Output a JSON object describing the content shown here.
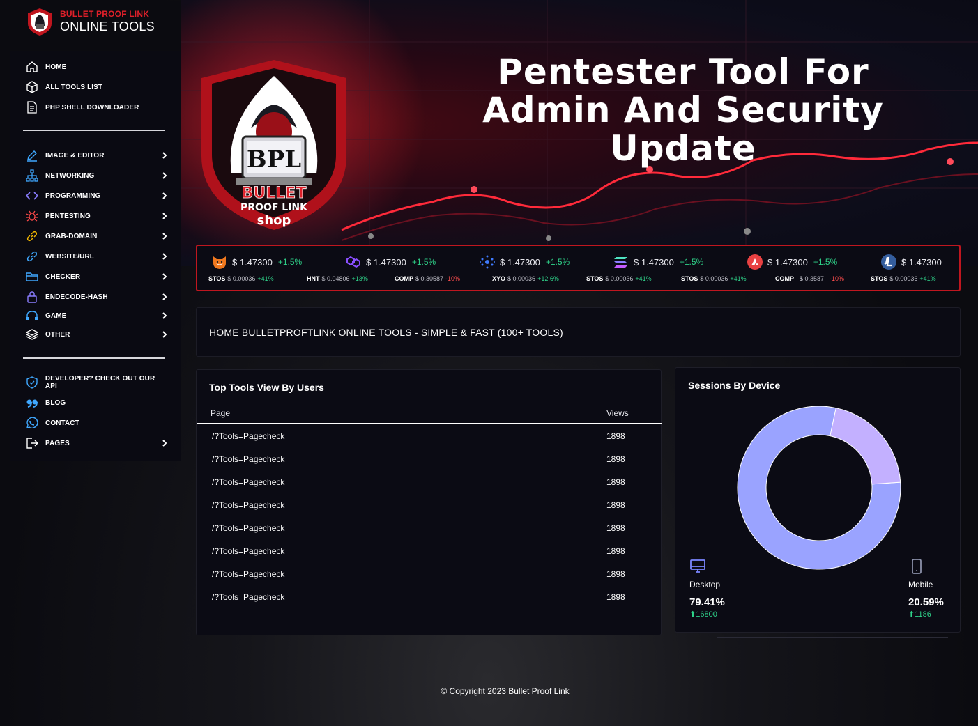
{
  "brand": {
    "line1": "BULLET PROOF LINK",
    "line2": "ONLINE TOOLS"
  },
  "sidebar": {
    "top": [
      {
        "label": "HOME",
        "icon": "home-icon"
      },
      {
        "label": "ALL TOOLS LIST",
        "icon": "box-icon"
      },
      {
        "label": "PHP SHELL DOWNLOADER",
        "icon": "file-icon"
      }
    ],
    "categories": [
      {
        "label": "IMAGE & EDITOR",
        "icon": "pen-icon"
      },
      {
        "label": "NETWORKING",
        "icon": "network-icon"
      },
      {
        "label": "PROGRAMMING",
        "icon": "code-icon"
      },
      {
        "label": "PENTESTING",
        "icon": "bug-icon"
      },
      {
        "label": "GRAB-DOMAIN",
        "icon": "link-icon"
      },
      {
        "label": "WEBSITE/URL",
        "icon": "url-icon"
      },
      {
        "label": "CHECKER",
        "icon": "folder-icon"
      },
      {
        "label": "ENDECODE-HASH",
        "icon": "lock-icon"
      },
      {
        "label": "GAME",
        "icon": "headset-icon"
      },
      {
        "label": "OTHER",
        "icon": "layers-icon"
      }
    ],
    "bottom": [
      {
        "label": "DEVELOPER? CHECK OUT OUR API",
        "icon": "shield-icon"
      },
      {
        "label": "BLOG",
        "icon": "quote-icon"
      },
      {
        "label": "CONTACT",
        "icon": "whatsapp-icon"
      },
      {
        "label": "PAGES",
        "icon": "logout-icon"
      }
    ]
  },
  "banner": {
    "line1": "Pentester Tool For",
    "line2": "Admin And Security Update",
    "logo_text1": "BULLET",
    "logo_text2": "PROOF LINK",
    "logo_text3": "shop",
    "logo_monogram": "BPL"
  },
  "ticker": [
    {
      "coin": "shiba-icon",
      "price": "$ 1.47300",
      "change": "+1.5%",
      "sym": "STOS",
      "sub": "$ 0.00036",
      "subchg": "+41%",
      "neg": false
    },
    {
      "coin": "polygon-icon",
      "price": "$ 1.47300",
      "change": "+1.5%",
      "sym": "HNT",
      "sub": "$ 0.04806",
      "subchg": "+13%",
      "neg": false
    },
    {
      "coin": "cardano-icon",
      "price": "$ 1.47300",
      "change": "+1.5%",
      "sym": "COMP",
      "sub": "$ 0.30587",
      "subchg": "-10%",
      "neg": true
    },
    {
      "coin": "solana-icon",
      "price": "$ 1.47300",
      "change": "+1.5%",
      "sym": "XYO",
      "sub": "$ 0.00036",
      "subchg": "+12.6%",
      "neg": false
    },
    {
      "coin": "avalanche-icon",
      "price": "$ 1.47300",
      "change": "+1.5%",
      "sym": "STOS",
      "sub": "$ 0.00036",
      "subchg": "+41%",
      "neg": false
    },
    {
      "coin": "litecoin-icon",
      "price": "$ 1.47300",
      "change": "",
      "sym": "STOS",
      "sub": "$ 0.00036",
      "subchg": "+41%",
      "neg": false
    },
    {
      "coin": "",
      "price": "",
      "change": "",
      "sym": "COMP",
      "sub": "$ 0.3587",
      "subchg": "-10%",
      "neg": true
    },
    {
      "coin": "",
      "price": "",
      "change": "",
      "sym": "STOS",
      "sub": "$ 0.00036",
      "subchg": "+41%",
      "neg": false
    }
  ],
  "heading": "HOME BULLETPROFTLINK ONLINE TOOLS - SIMPLE & FAST (100+ TOOLS)",
  "top_tools": {
    "title": "Top Tools View By Users",
    "col_page": "Page",
    "col_views": "Views",
    "rows": [
      {
        "page": "/?Tools=Pagecheck",
        "views": "1898"
      },
      {
        "page": "/?Tools=Pagecheck",
        "views": "1898"
      },
      {
        "page": "/?Tools=Pagecheck",
        "views": "1898"
      },
      {
        "page": "/?Tools=Pagecheck",
        "views": "1898"
      },
      {
        "page": "/?Tools=Pagecheck",
        "views": "1898"
      },
      {
        "page": "/?Tools=Pagecheck",
        "views": "1898"
      },
      {
        "page": "/?Tools=Pagecheck",
        "views": "1898"
      },
      {
        "page": "/?Tools=Pagecheck",
        "views": "1898"
      }
    ]
  },
  "sessions": {
    "title": "Sessions By Device",
    "desktop": {
      "label": "Desktop",
      "pct": "79.41%",
      "count": "16800",
      "fraction": 0.7941,
      "color": "#9aa3ff"
    },
    "mobile": {
      "label": "Mobile",
      "pct": "20.59%",
      "count": "1186",
      "fraction": 0.2059,
      "color": "#c3b0ff"
    }
  },
  "footer": "© Copyright 2023 Bullet Proof Link",
  "colors": {
    "accent": "#e0202a",
    "positive": "#2fd38a",
    "negative": "#ff4d4d"
  }
}
